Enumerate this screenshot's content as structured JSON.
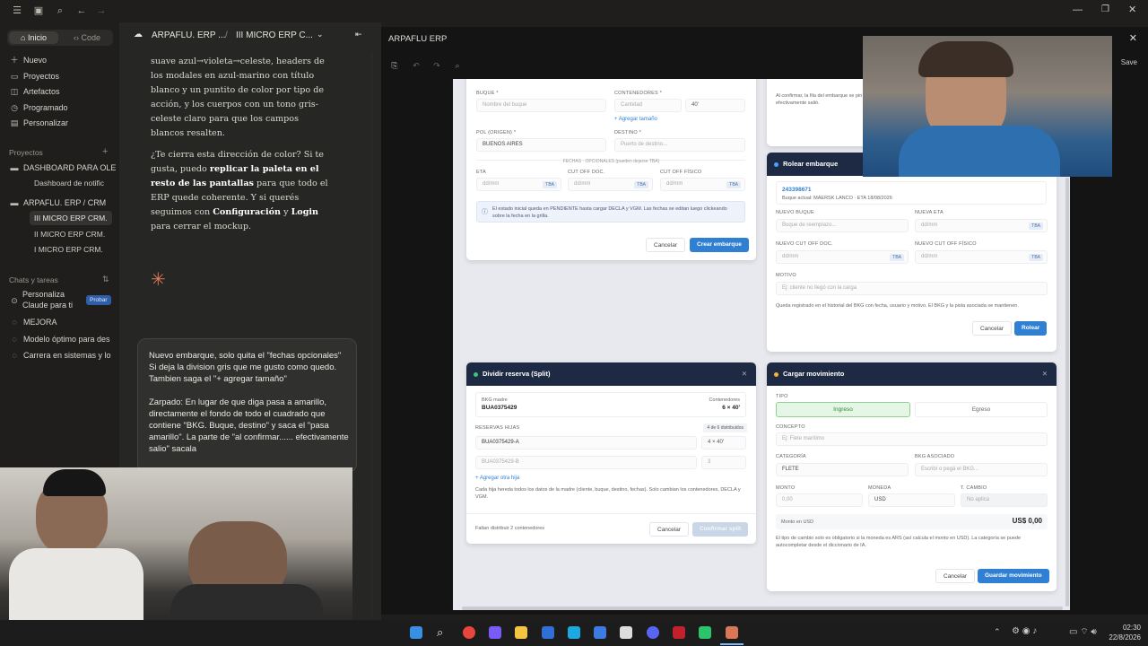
{
  "sidebar": {
    "tabs": [
      "Inicio",
      "Code"
    ],
    "nav": [
      "Nuevo",
      "Proyectos",
      "Artefactos",
      "Programado",
      "Personalizar"
    ],
    "projects_head": "Proyectos",
    "projects": [
      "DASHBOARD PARA OLE",
      "Dashboard de notific",
      "ARPAFLU. ERP / CRM",
      "III MICRO ERP CRM.",
      "II MICRO ERP CRM.",
      "I MICRO ERP CRM."
    ],
    "chats_head": "Chats y tareas",
    "chats": [
      "Personaliza Claude para ti",
      "MEJORA",
      "Modelo óptimo para des",
      "Carrera en sistemas y lo"
    ],
    "badge": "Probar"
  },
  "chat": {
    "breadcrumb_project": "ARPAFLU. ERP ...",
    "breadcrumb_sep": "/",
    "breadcrumb_chat": "III MICRO ERP C...",
    "p1_a": "suave azul→violeta→celeste, headers de los modales en azul-marino con título blanco y un puntito de color por tipo de acción, y los cuerpos con un tono gris-celeste claro para que los campos blancos resalten.",
    "p2_a": "¿Te cierra esta dirección de color? Si te gusta, puedo ",
    "p2_b": "replicar la paleta en el resto de las pantallas",
    "p2_c": " para que todo el ERP quede coherente. Y si querés seguimos con ",
    "p2_d": "Configuración",
    "p2_e": " y ",
    "p2_f": "Login",
    "p2_g": " para cerrar el mockup.",
    "composer_1": "Nuevo embarque, solo quita el \"fechas opcionales\" Si deja la division gris que me gusto como quedo. Tambien saga el \"+ agregar tamaño\"",
    "composer_2": "Zarpado: En lugar de que diga pasa a amarillo, directamente el fondo de todo el cuadrado que contiene \"BKG. Buque, destino\" y saca el \"pasa amarillo\". La parte de \"al confirmar...... efectivamente salio\" sacala"
  },
  "window": {
    "title": "ARPAFLU ERP",
    "save": "Save"
  },
  "nuevo_embarque": {
    "buque_label": "BUQUE *",
    "buque_ph": "Nombre del buque",
    "cont_label": "CONTENEDORES *",
    "cant_ph": "Cantidad",
    "size": "40'",
    "add_size": "+ Agregar tamaño",
    "pol_label": "POL (ORIGEN) *",
    "pol_val": "BUENOS AIRES",
    "dest_label": "DESTINO *",
    "dest_ph": "Puerto de destino...",
    "fechas": "FECHAS · OPCIONALES (pueden dejarse TBA)",
    "eta": "ETA",
    "cutdoc": "CUT OFF DOC.",
    "cutfis": "CUT OFF FÍSICO",
    "date_ph": "dd/mm",
    "tba": "TBA",
    "info": "El estado inicial queda en PENDIENTE hasta cargar DECLA y VGM. Las fechas se editan luego clickeando sobre la fecha en la grilla.",
    "cancel": "Cancelar",
    "create": "Crear embarque"
  },
  "rolear": {
    "top_note": "Al confirmar, la fila del embarque se pin efectivamente salió.",
    "title": "Rolear embarque",
    "bkg": "243398671",
    "bkg_sub": "Buque actual: MAERSK LANCO · ETA 18/08/2026",
    "nuevo_buque": "NUEVO BUQUE",
    "nb_ph": "Buque de reemplazo...",
    "nueva_eta": "NUEVA ETA",
    "cut_doc": "NUEVO CUT OFF DOC.",
    "cut_fis": "NUEVO CUT OFF FÍSICO",
    "date_ph": "dd/mm",
    "tba": "TBA",
    "motivo": "MOTIVO",
    "motivo_ph": "Ej: cliente no llegó con la carga",
    "note": "Queda registrado en el historial del BKG con fecha, usuario y motivo. El BKG y la pista asociada se mantienen.",
    "cancel": "Cancelar",
    "ok": "Rolear"
  },
  "dividir": {
    "title": "Dividir reserva (Split)",
    "bkg_madre": "BKG madre",
    "bkg_val": "BUA0375429",
    "contenedores": "Contenedores",
    "cont_val": "6 × 40'",
    "hijas": "RESERVAS HIJAS",
    "distrib": "4 de 6 distribuidos",
    "hija1": "BUA0375429-A",
    "hija1_q": "4 × 40'",
    "hija2": "BUA0375429-B",
    "hija2_q": "3",
    "add": "+ Agregar otra hija",
    "note": "Cada hija hereda todos los datos de la madre (cliente, buque, destino, fechas). Solo cambian los contenedores, DECLA y VGM.",
    "footer": "Faltan distribuir 2 contenedores",
    "cancel": "Cancelar",
    "ok": "Confirmar split"
  },
  "movimiento": {
    "title": "Cargar movimiento",
    "tipo": "TIPO",
    "ingreso": "Ingreso",
    "egreso": "Egreso",
    "concepto": "CONCEPTO",
    "concepto_ph": "Ej: Flete marítimo",
    "categoria": "CATEGORÍA",
    "cat_val": "FLETE",
    "bkg_asoc": "BKG ASOCIADO",
    "bkg_ph": "Escribí o pegá el BKG...",
    "monto": "MONTO",
    "monto_ph": "0,00",
    "moneda": "MONEDA",
    "moneda_val": "USD",
    "tcambio": "T. CAMBIO",
    "tc_ph": "No aplica",
    "monto_usd": "Monto en USD",
    "monto_usd_val": "US$ 0,00",
    "note": "El tipo de cambio solo es obligatorio si la moneda es ARS (así calcula el monto en USD). La categoría se puede autocompletar desde el diccionario de IA.",
    "cancel": "Cancelar",
    "ok": "Guardar movimiento"
  },
  "taskbar": {
    "time": "02:30",
    "date": "22/8/2026"
  },
  "colors": {
    "accent": "#2f7fd3",
    "header": "#1e2a44",
    "ingreso": "#e6f6e6"
  }
}
